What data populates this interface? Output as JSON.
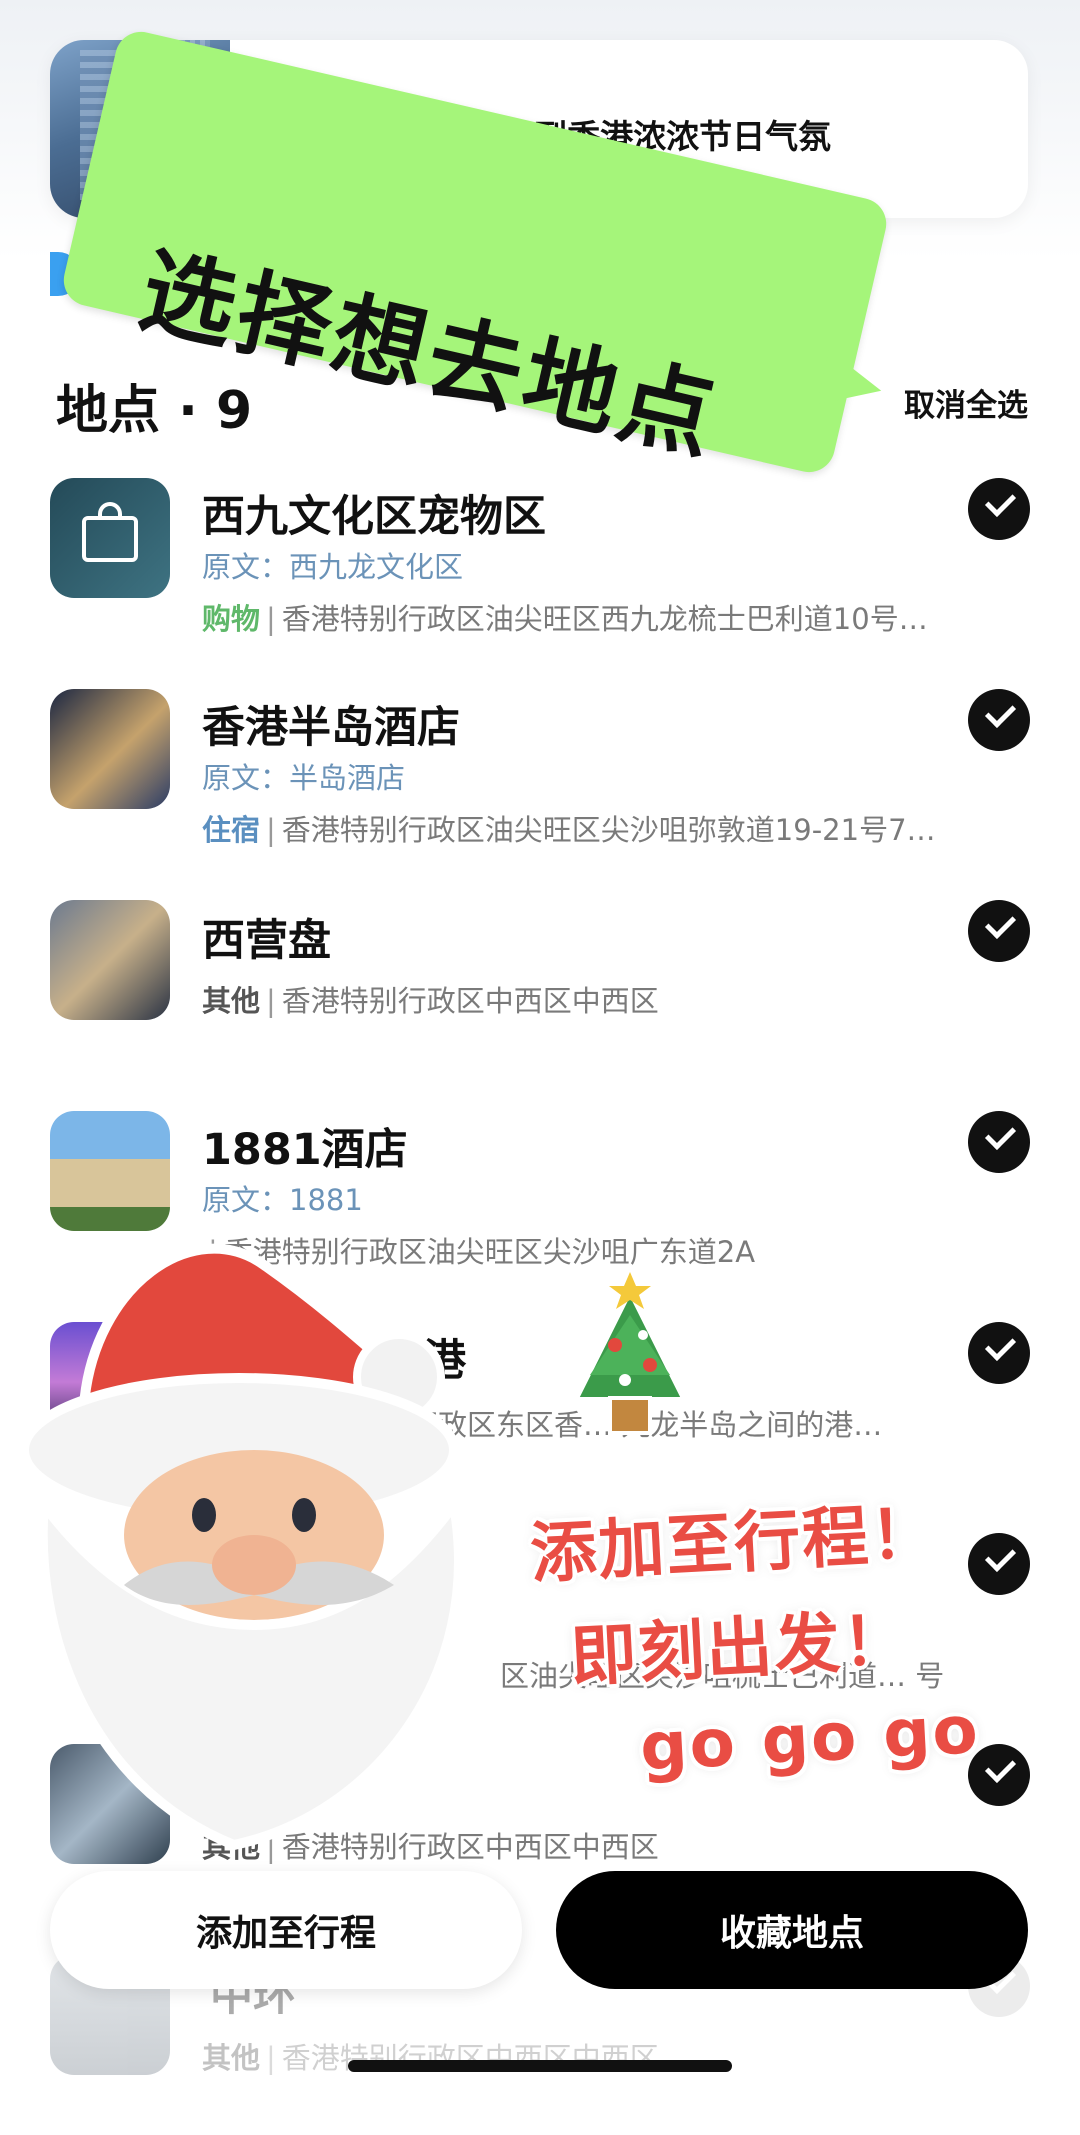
{
  "note": {
    "title": "暴走三万步🚶‍♀️我找到香港浓浓节日气氛"
  },
  "banner": {
    "text": "选择想去地点"
  },
  "section": {
    "title": "地点 · 9",
    "deselect_all": "取消全选"
  },
  "places": [
    {
      "name": "西九文化区宠物区",
      "orig": "原文：西九龙文化区",
      "category": "购物",
      "address": "香港特别行政区油尖旺区西九龙梳士巴利道10号…"
    },
    {
      "name": "香港半岛酒店",
      "orig": "原文：半岛酒店",
      "category": "住宿",
      "address": "香港特别行政区油尖旺区尖沙咀弥敦道19-21号7…"
    },
    {
      "name": "西营盘",
      "orig": "",
      "category": "其他",
      "address": "香港特别行政区中西区中西区"
    },
    {
      "name": "1881酒店",
      "orig": "原文：1881",
      "category": "",
      "address": "香港特别行政区油尖旺区尖沙咀广东道2A"
    },
    {
      "name": "维港",
      "orig": "",
      "category": "",
      "address": "别行政区东区香… 九龙半岛之间的港…"
    },
    {
      "name": "",
      "orig": "",
      "category": "",
      "address": "区油尖旺区尖沙咀梳士巴利道… 号"
    },
    {
      "name": "",
      "orig": "",
      "category": "其他",
      "address": "香港特别行政区中西区中西区"
    },
    {
      "name": "中环",
      "orig": "",
      "category": "其他",
      "address": "香港特别行政区中西区中西区"
    }
  ],
  "stickers": {
    "line1": "添加至行程！",
    "line2": "即刻出发！",
    "line3": "go go go"
  },
  "actions": {
    "add_label": "添加至行程",
    "save_label": "收藏地点"
  },
  "colors": {
    "banner": "#a5f57a",
    "category_shopping": "#5fb86a",
    "category_lodging": "#5a8fc0",
    "sticker_text": "#e94d44"
  }
}
